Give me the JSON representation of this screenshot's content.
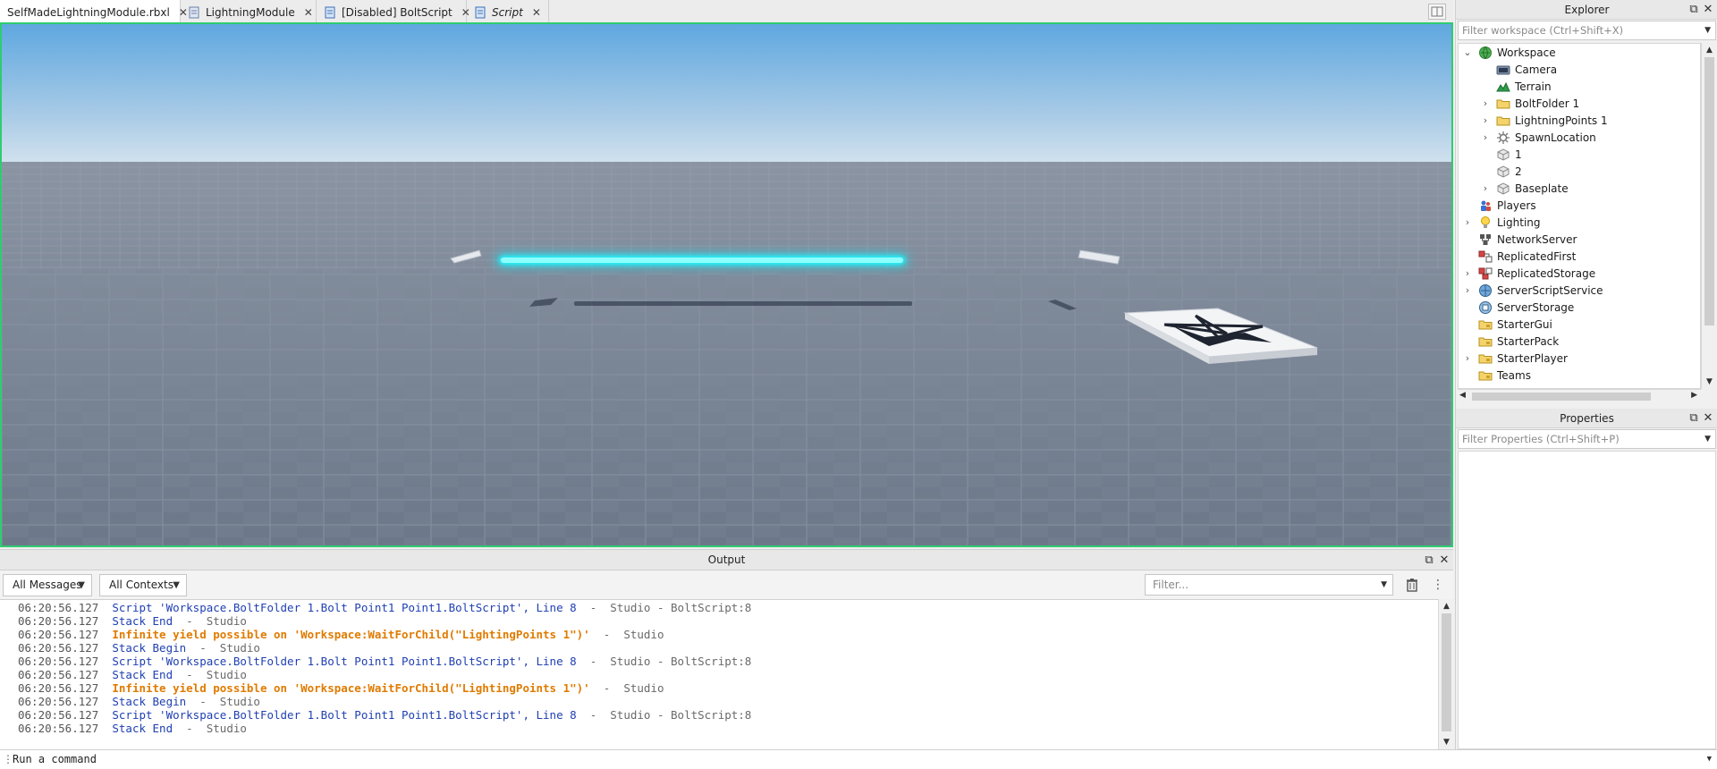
{
  "tabs": [
    {
      "label": "SelfMadeLightningModule.rbxl",
      "icon": "place-file-icon",
      "active": true
    },
    {
      "label": "LightningModule",
      "icon": "module-script-icon",
      "active": false
    },
    {
      "label": "[Disabled] BoltScript",
      "icon": "script-icon",
      "active": false
    },
    {
      "label": "Script",
      "icon": "script-icon",
      "active": false
    }
  ],
  "output": {
    "title": "Output",
    "messages_filter": "All Messages",
    "contexts_filter": "All Contexts",
    "filter_placeholder": "Filter...",
    "lines": [
      {
        "time": "06:20:56.127",
        "kind": "info",
        "text": "Script 'Workspace.BoltFolder 1.Bolt Point1 Point1.BoltScript', Line 8",
        "source": "  -  Studio - BoltScript:8"
      },
      {
        "time": "06:20:56.127",
        "kind": "info",
        "text": "Stack End",
        "source": "  -  Studio"
      },
      {
        "time": "06:20:56.127",
        "kind": "warn",
        "text": "Infinite yield possible on 'Workspace:WaitForChild(\"LightingPoints 1\")'",
        "source": "  -  Studio"
      },
      {
        "time": "06:20:56.127",
        "kind": "info",
        "text": "Stack Begin",
        "source": "  -  Studio"
      },
      {
        "time": "06:20:56.127",
        "kind": "info",
        "text": "Script 'Workspace.BoltFolder 1.Bolt Point1 Point1.BoltScript', Line 8",
        "source": "  -  Studio - BoltScript:8"
      },
      {
        "time": "06:20:56.127",
        "kind": "info",
        "text": "Stack End",
        "source": "  -  Studio"
      },
      {
        "time": "06:20:56.127",
        "kind": "warn",
        "text": "Infinite yield possible on 'Workspace:WaitForChild(\"LightingPoints 1\")'",
        "source": "  -  Studio"
      },
      {
        "time": "06:20:56.127",
        "kind": "info",
        "text": "Stack Begin",
        "source": "  -  Studio"
      },
      {
        "time": "06:20:56.127",
        "kind": "info",
        "text": "Script 'Workspace.BoltFolder 1.Bolt Point1 Point1.BoltScript', Line 8",
        "source": "  -  Studio - BoltScript:8"
      },
      {
        "time": "06:20:56.127",
        "kind": "info",
        "text": "Stack End",
        "source": "  -  Studio"
      }
    ]
  },
  "command_bar": {
    "placeholder": "Run a command"
  },
  "explorer": {
    "title": "Explorer",
    "filter_placeholder": "Filter workspace (Ctrl+Shift+X)",
    "items": [
      {
        "label": "Workspace",
        "depth": 0,
        "expander": "open",
        "icon": "workspace-globe-icon"
      },
      {
        "label": "Camera",
        "depth": 1,
        "expander": "none",
        "icon": "camera-icon"
      },
      {
        "label": "Terrain",
        "depth": 1,
        "expander": "none",
        "icon": "terrain-icon"
      },
      {
        "label": "BoltFolder 1",
        "depth": 1,
        "expander": "closed",
        "icon": "folder-icon"
      },
      {
        "label": "LightningPoints 1",
        "depth": 1,
        "expander": "closed",
        "icon": "folder-icon"
      },
      {
        "label": "SpawnLocation",
        "depth": 1,
        "expander": "closed",
        "icon": "spawn-location-icon"
      },
      {
        "label": "1",
        "depth": 1,
        "expander": "none",
        "icon": "part-icon"
      },
      {
        "label": "2",
        "depth": 1,
        "expander": "none",
        "icon": "part-icon"
      },
      {
        "label": "Baseplate",
        "depth": 1,
        "expander": "closed",
        "icon": "part-icon"
      },
      {
        "label": "Players",
        "depth": 0,
        "expander": "none",
        "icon": "players-icon"
      },
      {
        "label": "Lighting",
        "depth": 0,
        "expander": "closed",
        "icon": "lighting-bulb-icon"
      },
      {
        "label": "NetworkServer",
        "depth": 0,
        "expander": "none",
        "icon": "network-server-icon"
      },
      {
        "label": "ReplicatedFirst",
        "depth": 0,
        "expander": "none",
        "icon": "replicated-first-icon"
      },
      {
        "label": "ReplicatedStorage",
        "depth": 0,
        "expander": "closed",
        "icon": "replicated-storage-icon"
      },
      {
        "label": "ServerScriptService",
        "depth": 0,
        "expander": "closed",
        "icon": "server-script-service-icon"
      },
      {
        "label": "ServerStorage",
        "depth": 0,
        "expander": "none",
        "icon": "server-storage-icon"
      },
      {
        "label": "StarterGui",
        "depth": 0,
        "expander": "none",
        "icon": "starter-folder-icon"
      },
      {
        "label": "StarterPack",
        "depth": 0,
        "expander": "none",
        "icon": "starter-folder-icon"
      },
      {
        "label": "StarterPlayer",
        "depth": 0,
        "expander": "closed",
        "icon": "starter-folder-icon"
      },
      {
        "label": "Teams",
        "depth": 0,
        "expander": "none",
        "icon": "starter-folder-icon"
      }
    ]
  },
  "properties": {
    "title": "Properties",
    "filter_placeholder": "Filter Properties (Ctrl+Shift+P)"
  },
  "colors": {
    "viewport_border": "#2ecc71",
    "lightning_glow": "#00f2ff",
    "log_info": "#1f3fb2",
    "log_warn": "#e07b00"
  }
}
